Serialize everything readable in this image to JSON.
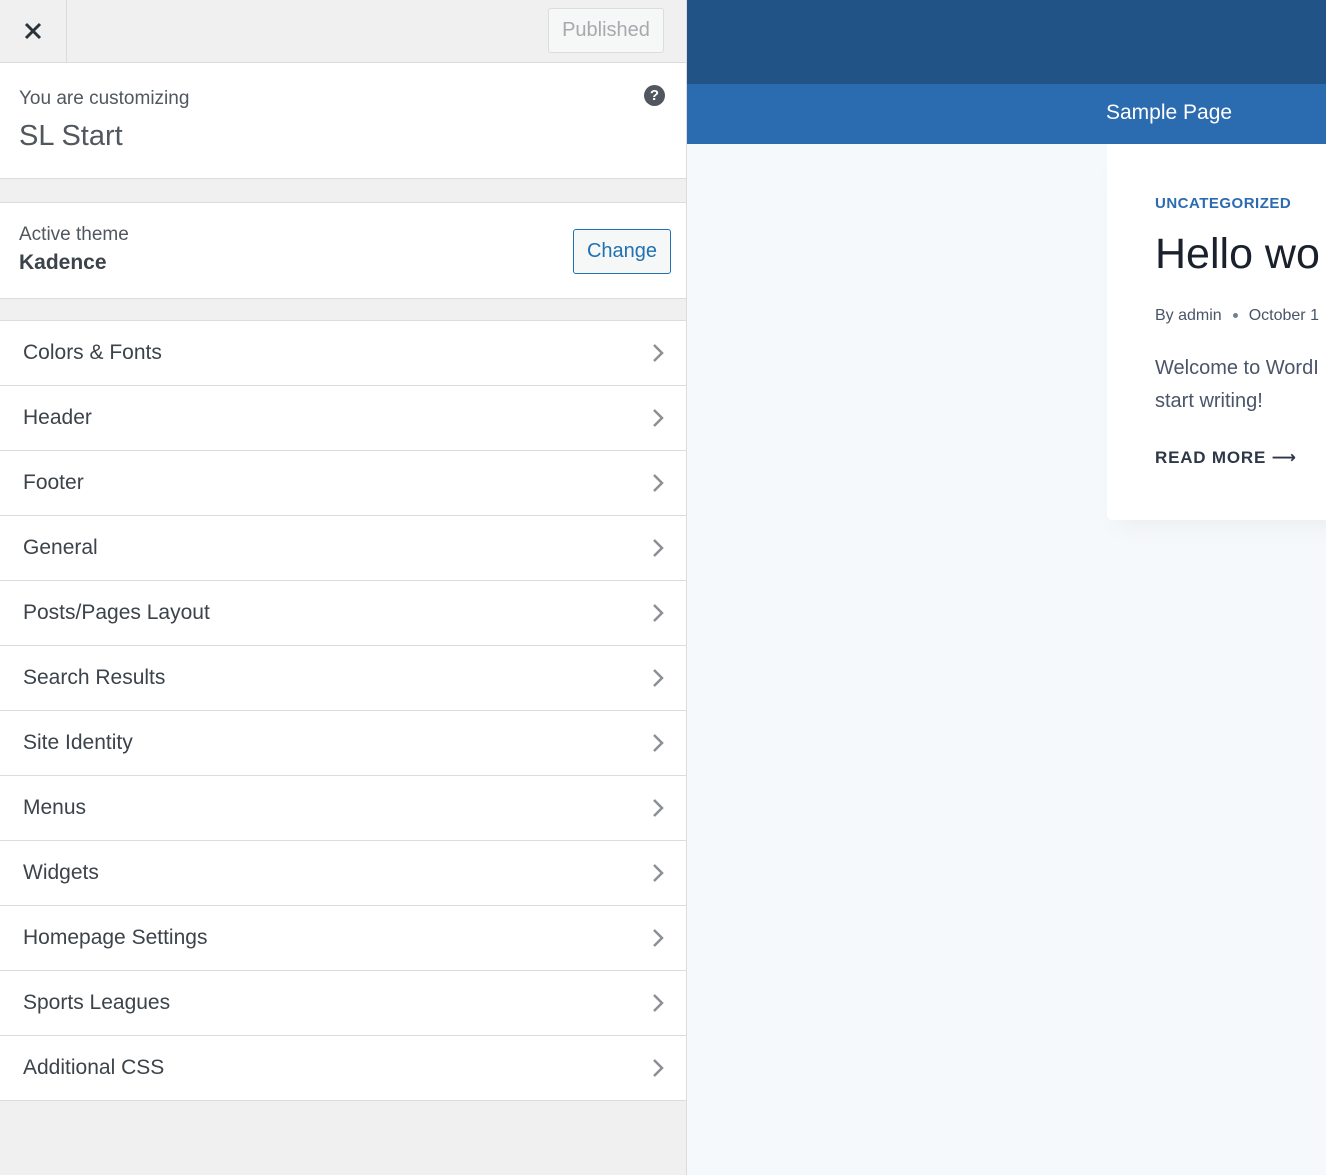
{
  "topbar": {
    "close_label": "×",
    "publish_label": "Published"
  },
  "info": {
    "pre_title": "You are customizing",
    "site_title": "SL Start",
    "help_icon": "?"
  },
  "theme": {
    "label": "Active theme",
    "name": "Kadence",
    "change_label": "Change"
  },
  "sections": [
    {
      "label": "Colors & Fonts"
    },
    {
      "label": "Header"
    },
    {
      "label": "Footer"
    },
    {
      "label": "General"
    },
    {
      "label": "Posts/Pages Layout"
    },
    {
      "label": "Search Results"
    },
    {
      "label": "Site Identity"
    },
    {
      "label": "Menus"
    },
    {
      "label": "Widgets"
    },
    {
      "label": "Homepage Settings"
    },
    {
      "label": "Sports Leagues"
    },
    {
      "label": "Additional CSS"
    }
  ],
  "preview": {
    "nav_item": "Sample Page",
    "post": {
      "category": "UNCATEGORIZED",
      "title": "Hello wo",
      "author": "By admin",
      "date": "October 1",
      "excerpt_line1": "Welcome to WordI",
      "excerpt_line2": "start writing!",
      "read_more": "READ MORE ⟶"
    }
  },
  "colors": {
    "header_dark": "#215387",
    "nav": "#2b6cb0",
    "accent": "#2271b1"
  }
}
